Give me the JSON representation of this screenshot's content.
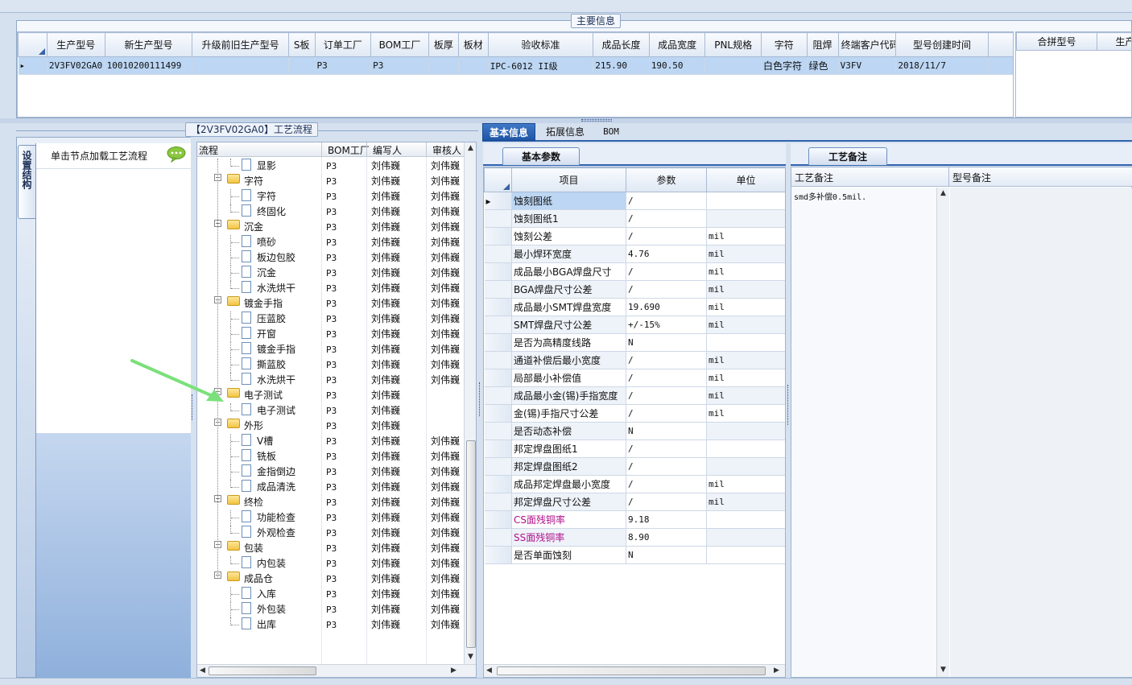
{
  "top_group": {
    "title": "主要信息",
    "columns": [
      "生产型号",
      "新生产型号",
      "升级前旧生产型号",
      "S板",
      "订单工厂",
      "BOM工厂",
      "板厚",
      "板材",
      "验收标准",
      "成品长度",
      "成品宽度",
      "PNL规格",
      "字符",
      "阻焊",
      "终端客户代码",
      "型号创建时间"
    ],
    "row": [
      "2V3FV02GA0",
      "10010200111499",
      "",
      "",
      "P3",
      "P3",
      "",
      "",
      "IPC-6012 II级",
      "215.90",
      "190.50",
      "",
      "白色字符",
      "绿色",
      "V3FV",
      "2018/11/7"
    ],
    "right_columns": [
      "合拼型号",
      "生产"
    ]
  },
  "left_panel": {
    "vertical_tab": "设置结构",
    "hint": "单击节点加载工艺流程",
    "hint_icon": "speech-bubble-icon"
  },
  "flow": {
    "title": "【2V3FV02GA0】工艺流程",
    "columns": [
      "流程",
      "BOM工厂",
      "编写人",
      "审核人"
    ],
    "rows": [
      {
        "level": 2,
        "name": "显影",
        "bom": "P3",
        "author": "刘伟巍",
        "reviewer": "刘伟巍"
      },
      {
        "level": 1,
        "name": "字符",
        "bom": "P3",
        "author": "刘伟巍",
        "reviewer": "刘伟巍"
      },
      {
        "level": 2,
        "name": "字符",
        "bom": "P3",
        "author": "刘伟巍",
        "reviewer": "刘伟巍"
      },
      {
        "level": 2,
        "name": "终固化",
        "bom": "P3",
        "author": "刘伟巍",
        "reviewer": "刘伟巍"
      },
      {
        "level": 1,
        "name": "沉金",
        "bom": "P3",
        "author": "刘伟巍",
        "reviewer": "刘伟巍"
      },
      {
        "level": 2,
        "name": "喷砂",
        "bom": "P3",
        "author": "刘伟巍",
        "reviewer": "刘伟巍"
      },
      {
        "level": 2,
        "name": "板边包胶",
        "bom": "P3",
        "author": "刘伟巍",
        "reviewer": "刘伟巍"
      },
      {
        "level": 2,
        "name": "沉金",
        "bom": "P3",
        "author": "刘伟巍",
        "reviewer": "刘伟巍"
      },
      {
        "level": 2,
        "name": "水洗烘干",
        "bom": "P3",
        "author": "刘伟巍",
        "reviewer": "刘伟巍"
      },
      {
        "level": 1,
        "name": "镀金手指",
        "bom": "P3",
        "author": "刘伟巍",
        "reviewer": "刘伟巍"
      },
      {
        "level": 2,
        "name": "压蓝胶",
        "bom": "P3",
        "author": "刘伟巍",
        "reviewer": "刘伟巍"
      },
      {
        "level": 2,
        "name": "开窗",
        "bom": "P3",
        "author": "刘伟巍",
        "reviewer": "刘伟巍"
      },
      {
        "level": 2,
        "name": "镀金手指",
        "bom": "P3",
        "author": "刘伟巍",
        "reviewer": "刘伟巍"
      },
      {
        "level": 2,
        "name": "撕蓝胶",
        "bom": "P3",
        "author": "刘伟巍",
        "reviewer": "刘伟巍"
      },
      {
        "level": 2,
        "name": "水洗烘干",
        "bom": "P3",
        "author": "刘伟巍",
        "reviewer": "刘伟巍"
      },
      {
        "level": 1,
        "name": "电子测试",
        "bom": "P3",
        "author": "刘伟巍",
        "reviewer": ""
      },
      {
        "level": 2,
        "name": "电子测试",
        "bom": "P3",
        "author": "刘伟巍",
        "reviewer": ""
      },
      {
        "level": 1,
        "name": "外形",
        "bom": "P3",
        "author": "刘伟巍",
        "reviewer": ""
      },
      {
        "level": 2,
        "name": "V槽",
        "bom": "P3",
        "author": "刘伟巍",
        "reviewer": "刘伟巍"
      },
      {
        "level": 2,
        "name": "铣板",
        "bom": "P3",
        "author": "刘伟巍",
        "reviewer": "刘伟巍"
      },
      {
        "level": 2,
        "name": "金指倒边",
        "bom": "P3",
        "author": "刘伟巍",
        "reviewer": "刘伟巍"
      },
      {
        "level": 2,
        "name": "成品清洗",
        "bom": "P3",
        "author": "刘伟巍",
        "reviewer": "刘伟巍"
      },
      {
        "level": 1,
        "name": "终检",
        "bom": "P3",
        "author": "刘伟巍",
        "reviewer": "刘伟巍"
      },
      {
        "level": 2,
        "name": "功能检查",
        "bom": "P3",
        "author": "刘伟巍",
        "reviewer": "刘伟巍"
      },
      {
        "level": 2,
        "name": "外观检查",
        "bom": "P3",
        "author": "刘伟巍",
        "reviewer": "刘伟巍"
      },
      {
        "level": 1,
        "name": "包装",
        "bom": "P3",
        "author": "刘伟巍",
        "reviewer": "刘伟巍"
      },
      {
        "level": 2,
        "name": "内包装",
        "bom": "P3",
        "author": "刘伟巍",
        "reviewer": "刘伟巍"
      },
      {
        "level": 1,
        "name": "成品仓",
        "bom": "P3",
        "author": "刘伟巍",
        "reviewer": "刘伟巍"
      },
      {
        "level": 2,
        "name": "入库",
        "bom": "P3",
        "author": "刘伟巍",
        "reviewer": "刘伟巍"
      },
      {
        "level": 2,
        "name": "外包装",
        "bom": "P3",
        "author": "刘伟巍",
        "reviewer": "刘伟巍"
      },
      {
        "level": 2,
        "name": "出库",
        "bom": "P3",
        "author": "刘伟巍",
        "reviewer": "刘伟巍"
      }
    ]
  },
  "tabs": [
    "基本信息",
    "拓展信息",
    "BOM"
  ],
  "basic_params": {
    "title": "基本参数",
    "columns": [
      "项目",
      "参数",
      "单位"
    ],
    "rows": [
      [
        "蚀刻图纸",
        "/",
        ""
      ],
      [
        "蚀刻图纸1",
        "/",
        ""
      ],
      [
        "蚀刻公差",
        "/",
        "mil"
      ],
      [
        "最小焊环宽度",
        "4.76",
        "mil"
      ],
      [
        "成品最小BGA焊盘尺寸",
        "/",
        "mil"
      ],
      [
        "BGA焊盘尺寸公差",
        "/",
        "mil"
      ],
      [
        "成品最小SMT焊盘宽度",
        "19.690",
        "mil"
      ],
      [
        "SMT焊盘尺寸公差",
        "+/-15%",
        "mil"
      ],
      [
        "是否为高精度线路",
        "N",
        ""
      ],
      [
        "通道补偿后最小宽度",
        "/",
        "mil"
      ],
      [
        "局部最小补偿值",
        "/",
        "mil"
      ],
      [
        "成品最小金(锡)手指宽度",
        "/",
        "mil"
      ],
      [
        "金(锡)手指尺寸公差",
        "/",
        "mil"
      ],
      [
        "是否动态补偿",
        "N",
        ""
      ],
      [
        "邦定焊盘图纸1",
        "/",
        ""
      ],
      [
        "邦定焊盘图纸2",
        "/",
        ""
      ],
      [
        "成品邦定焊盘最小宽度",
        "/",
        "mil"
      ],
      [
        "邦定焊盘尺寸公差",
        "/",
        "mil"
      ],
      [
        "CS面残铜率",
        "9.18",
        ""
      ],
      [
        "SS面残铜率",
        "8.90",
        ""
      ],
      [
        "是否单面蚀刻",
        "N",
        ""
      ]
    ]
  },
  "process_notes": {
    "title": "工艺备注",
    "col1": "工艺备注",
    "col2": "型号备注",
    "note_text": "smd多补偿0.5mil."
  },
  "colors": {
    "accent": "#2060b0",
    "selection": "#bcd6f3",
    "magenta": "#b0108a",
    "arrow": "#7be07b"
  }
}
